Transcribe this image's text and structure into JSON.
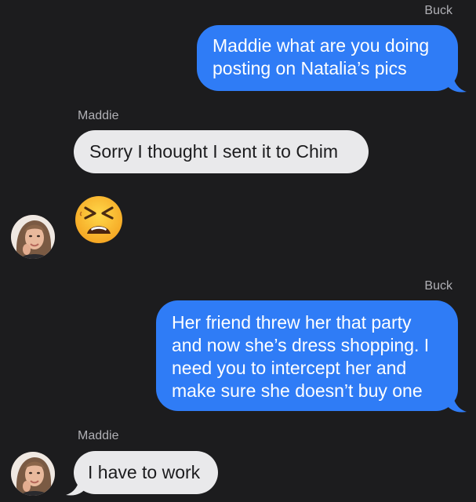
{
  "conversation": {
    "messages": [
      {
        "sender": "Buck",
        "text": "Maddie what are you doing posting on Natalia’s pics"
      },
      {
        "sender": "Maddie",
        "text": "Sorry I thought I sent it to Chim"
      },
      {
        "sender": "Maddie",
        "emoji": "tired-face-emoji"
      },
      {
        "sender": "Buck",
        "text": "Her friend threw her that party and now she’s dress shopping. I need you to intercept her and make sure she doesn’t buy one"
      },
      {
        "sender": "Maddie",
        "text": "I have to work"
      }
    ]
  },
  "colors": {
    "background": "#1c1c1e",
    "outgoing_bubble": "#2f7cf6",
    "incoming_bubble": "#e9e9eb",
    "sender_label": "#b0b0b5"
  }
}
